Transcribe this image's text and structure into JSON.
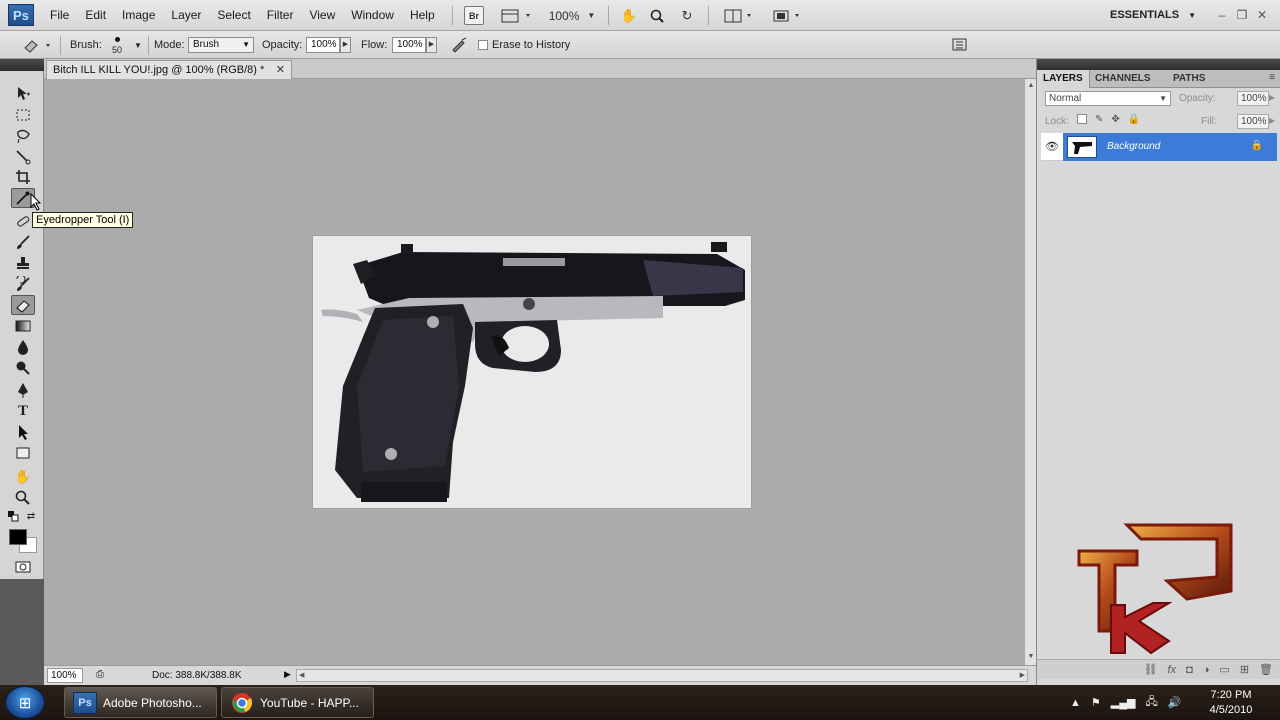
{
  "app": {
    "logo": "Ps"
  },
  "menus": [
    "File",
    "Edit",
    "Image",
    "Layer",
    "Select",
    "Filter",
    "View",
    "Window",
    "Help"
  ],
  "app_bar": {
    "bridge": "Br",
    "zoom": "100%",
    "workspace": "ESSENTIALS"
  },
  "options_bar": {
    "brush_label": "Brush:",
    "brush_size": "50",
    "mode_label": "Mode:",
    "mode_value": "Brush",
    "opacity_label": "Opacity:",
    "opacity_value": "100%",
    "flow_label": "Flow:",
    "flow_value": "100%",
    "erase_to_history": "Erase to History"
  },
  "document": {
    "tab_title": "Bitch ILL KILL YOU!.jpg @ 100% (RGB/8) *",
    "zoom": "100%",
    "doc_info": "Doc: 388.8K/388.8K"
  },
  "tooltip": "Eyedropper Tool (I)",
  "layers_panel": {
    "tabs": [
      "LAYERS",
      "CHANNELS",
      "PATHS"
    ],
    "blend_mode": "Normal",
    "opacity_label": "Opacity:",
    "opacity_value": "100%",
    "lock_label": "Lock:",
    "fill_label": "Fill:",
    "fill_value": "100%",
    "layer_name": "Background"
  },
  "taskbar": {
    "items": [
      {
        "label": "Adobe Photosho...",
        "icon": "Ps"
      },
      {
        "label": "YouTube - HAPP...",
        "icon": "chrome"
      }
    ],
    "time": "7:20 PM",
    "date": "4/5/2010"
  },
  "colors": {
    "accent": "#3d7bd9",
    "workspace": "#ababab",
    "tooltip": "#ffffe1"
  }
}
